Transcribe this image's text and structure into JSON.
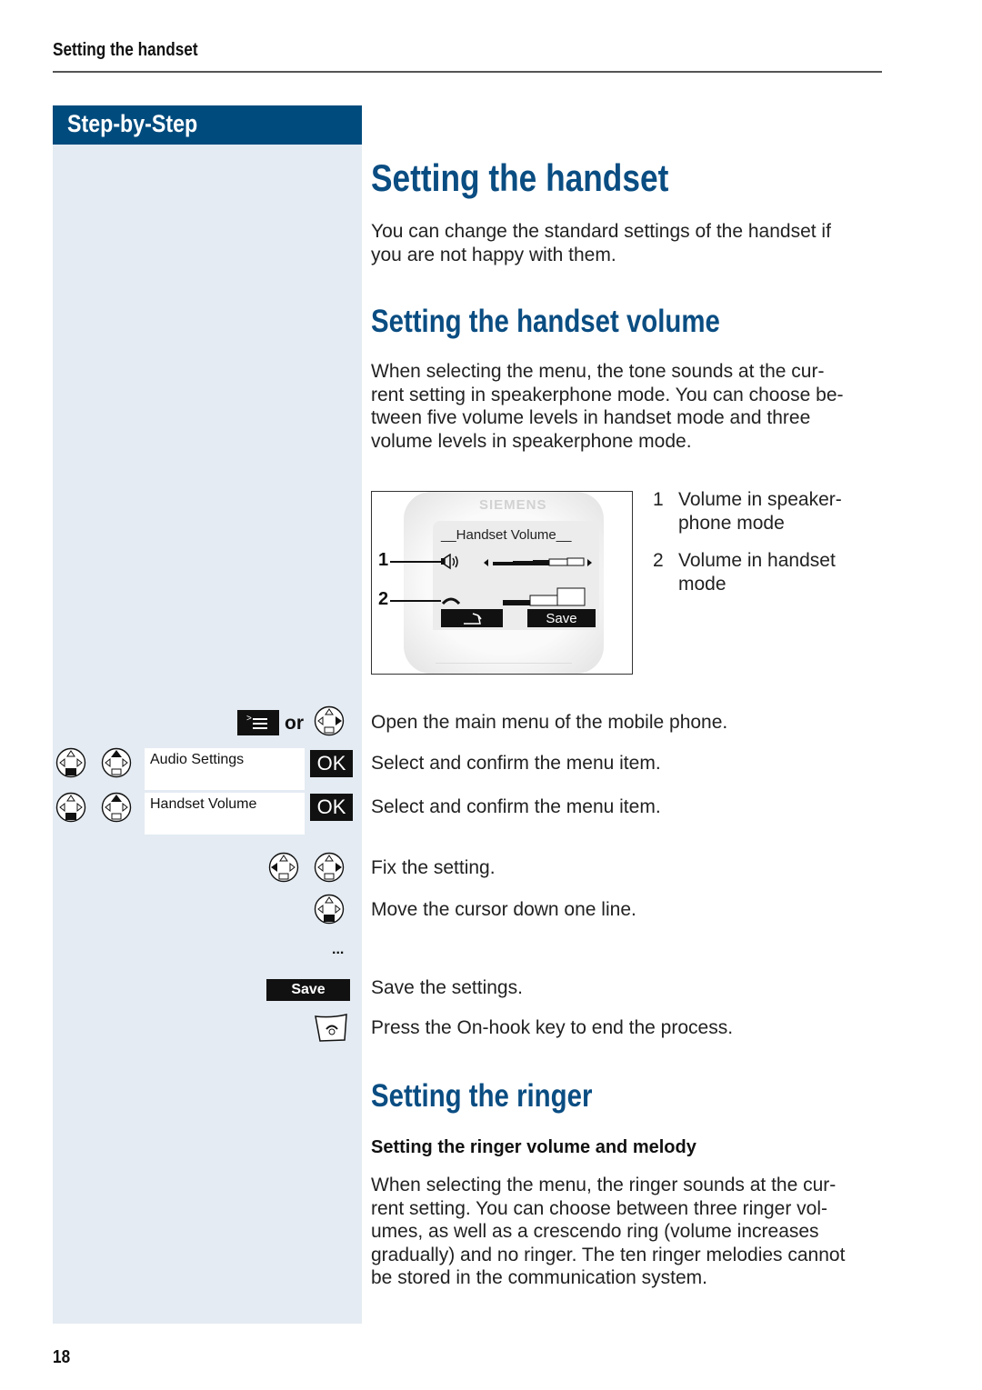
{
  "running_head": "Setting the handset",
  "sidebar": {
    "title": "Step-by-Step",
    "steps": [
      {
        "keys": [
          "menu-key",
          "or",
          "nav-right"
        ],
        "or_label": "or"
      },
      {
        "keys": [
          "nav-down-book",
          "nav-up"
        ],
        "menu_item": "Audio Settings",
        "confirm_label": "OK"
      },
      {
        "keys": [
          "nav-down-book",
          "nav-up"
        ],
        "menu_item": "Handset Volume",
        "confirm_label": "OK"
      },
      {
        "keys": [
          "nav-left",
          "nav-right"
        ]
      },
      {
        "keys": [
          "nav-down-book"
        ]
      },
      {
        "ellipsis": "..."
      },
      {
        "softkey_label": "Save"
      },
      {
        "keys": [
          "on-hook-key"
        ]
      }
    ]
  },
  "main": {
    "title": "Setting the handset",
    "intro": [
      "You can change the standard settings of the handset if",
      "you are not happy with them."
    ],
    "section_volume": {
      "title": "Setting the handset volume",
      "para": [
        "When selecting the menu, the tone sounds at the cur-",
        "rent setting in speakerphone mode. You can choose be-",
        "tween five volume levels in handset mode and three",
        "volume levels in speakerphone mode."
      ],
      "figure": {
        "brand": "SIEMENS",
        "screen_title": "__Handset Volume__",
        "callout_1": "1",
        "callout_2": "2",
        "speaker_level": "3 of 5",
        "handset_level": "1 of 3",
        "softkey_back": "back-arrow",
        "softkey_save": "Save"
      },
      "legend": [
        {
          "num": "1",
          "lines": [
            "Volume in speaker-",
            "phone mode"
          ]
        },
        {
          "num": "2",
          "lines": [
            "Volume in handset",
            "mode"
          ]
        }
      ],
      "steps": [
        "Open the main menu of the mobile phone.",
        "Select and confirm the menu item.",
        "Select and confirm the menu item.",
        "Fix the setting.",
        "Move the cursor down one line.",
        "Save the settings.",
        "Press the On-hook key to end the process."
      ]
    },
    "section_ringer": {
      "title": "Setting the ringer",
      "subtitle": "Setting the ringer volume and melody",
      "para": [
        "When selecting the menu, the ringer sounds at the cur-",
        "rent setting. You can choose between three ringer vol-",
        "umes, as well as a crescendo ring (volume increases",
        "gradually) and no ringer. The ten ringer melodies cannot",
        "be stored in the communication system."
      ]
    }
  },
  "page_number": "18",
  "colors": {
    "accent": "#0a4d82",
    "sidebar_header": "#004b7d",
    "sidebar_bg": "#e4ebf2"
  }
}
